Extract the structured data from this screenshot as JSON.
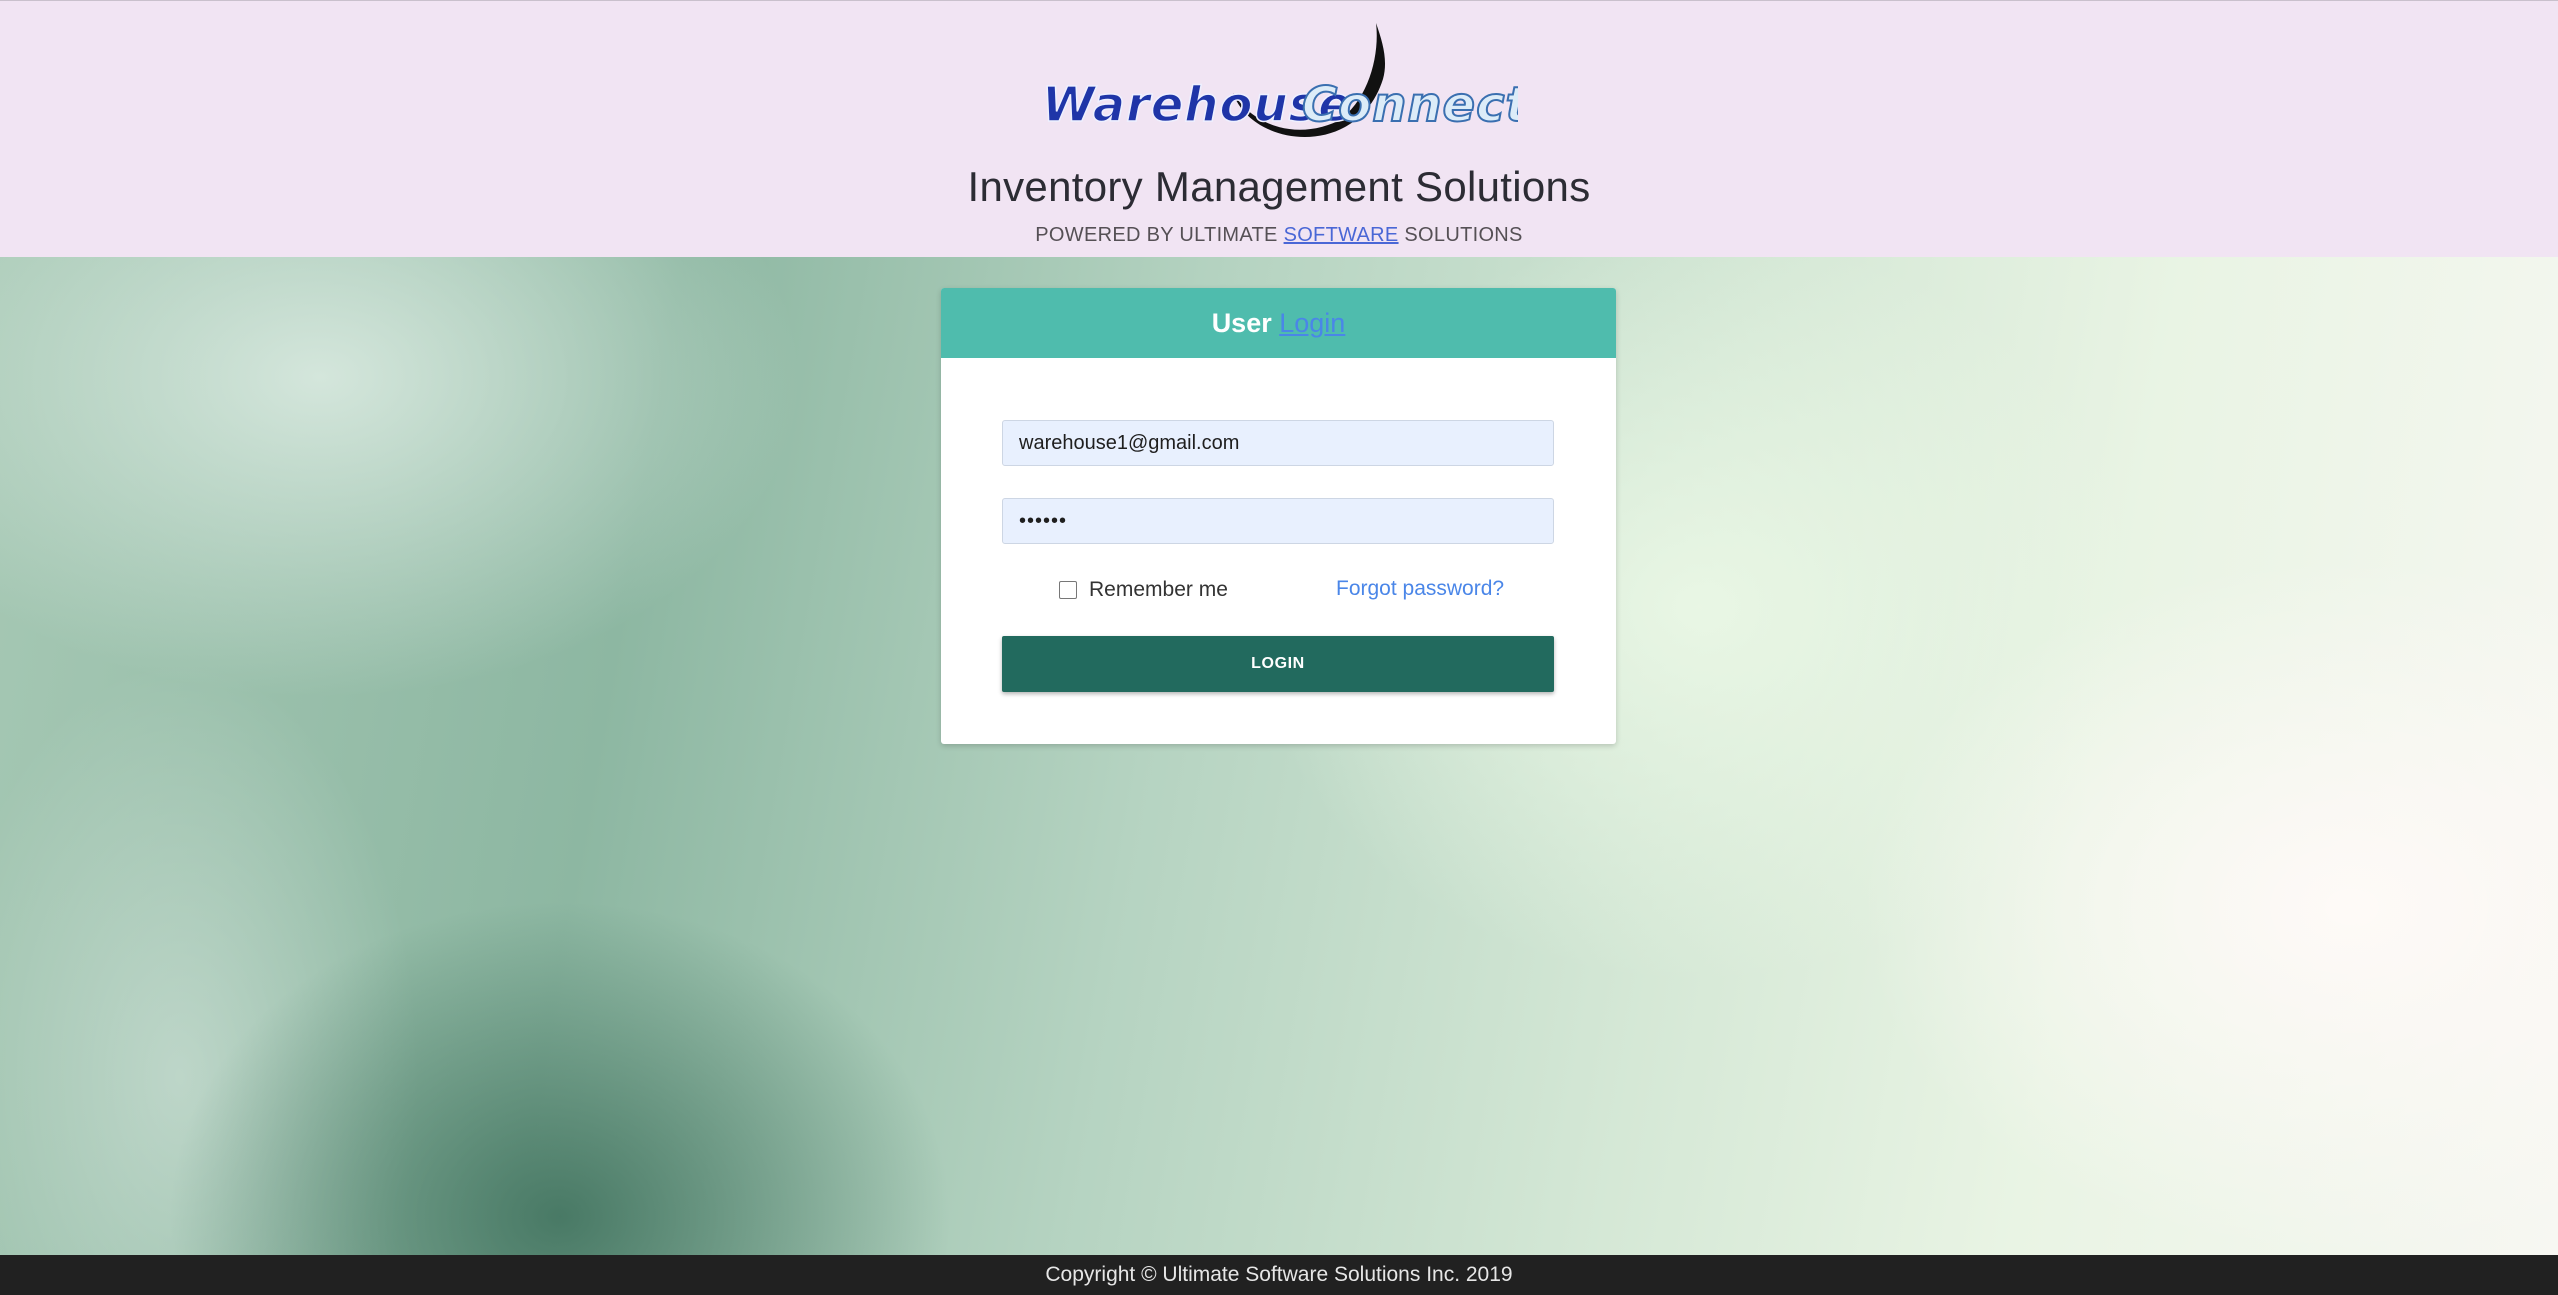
{
  "header": {
    "logo": {
      "word_1": "Warehouse",
      "word_2": "Connect"
    },
    "tagline": "Inventory Management Solutions",
    "powered_by": {
      "prefix": "POWERED BY ULTIMATE ",
      "link": "SOFTWARE",
      "suffix": " SOLUTIONS"
    }
  },
  "login_card": {
    "title_user": "User ",
    "title_link": "Login",
    "email_value": "warehouse1@gmail.com",
    "password_value": "••••••",
    "remember_label": "Remember me",
    "remember_checked": false,
    "forgot_link": "Forgot password?",
    "login_button": "LOGIN"
  },
  "footer": {
    "copyright": "Copyright © Ultimate Software Solutions Inc. 2019"
  },
  "colors": {
    "header_bg": "#f1e4f3",
    "card_header_bg": "#4fbcad",
    "button_bg": "#226a5e",
    "link": "#4a86e8",
    "logo_blue": "#1f35a8",
    "logo_light": "#dcecf8",
    "footer_bg": "#212121"
  }
}
